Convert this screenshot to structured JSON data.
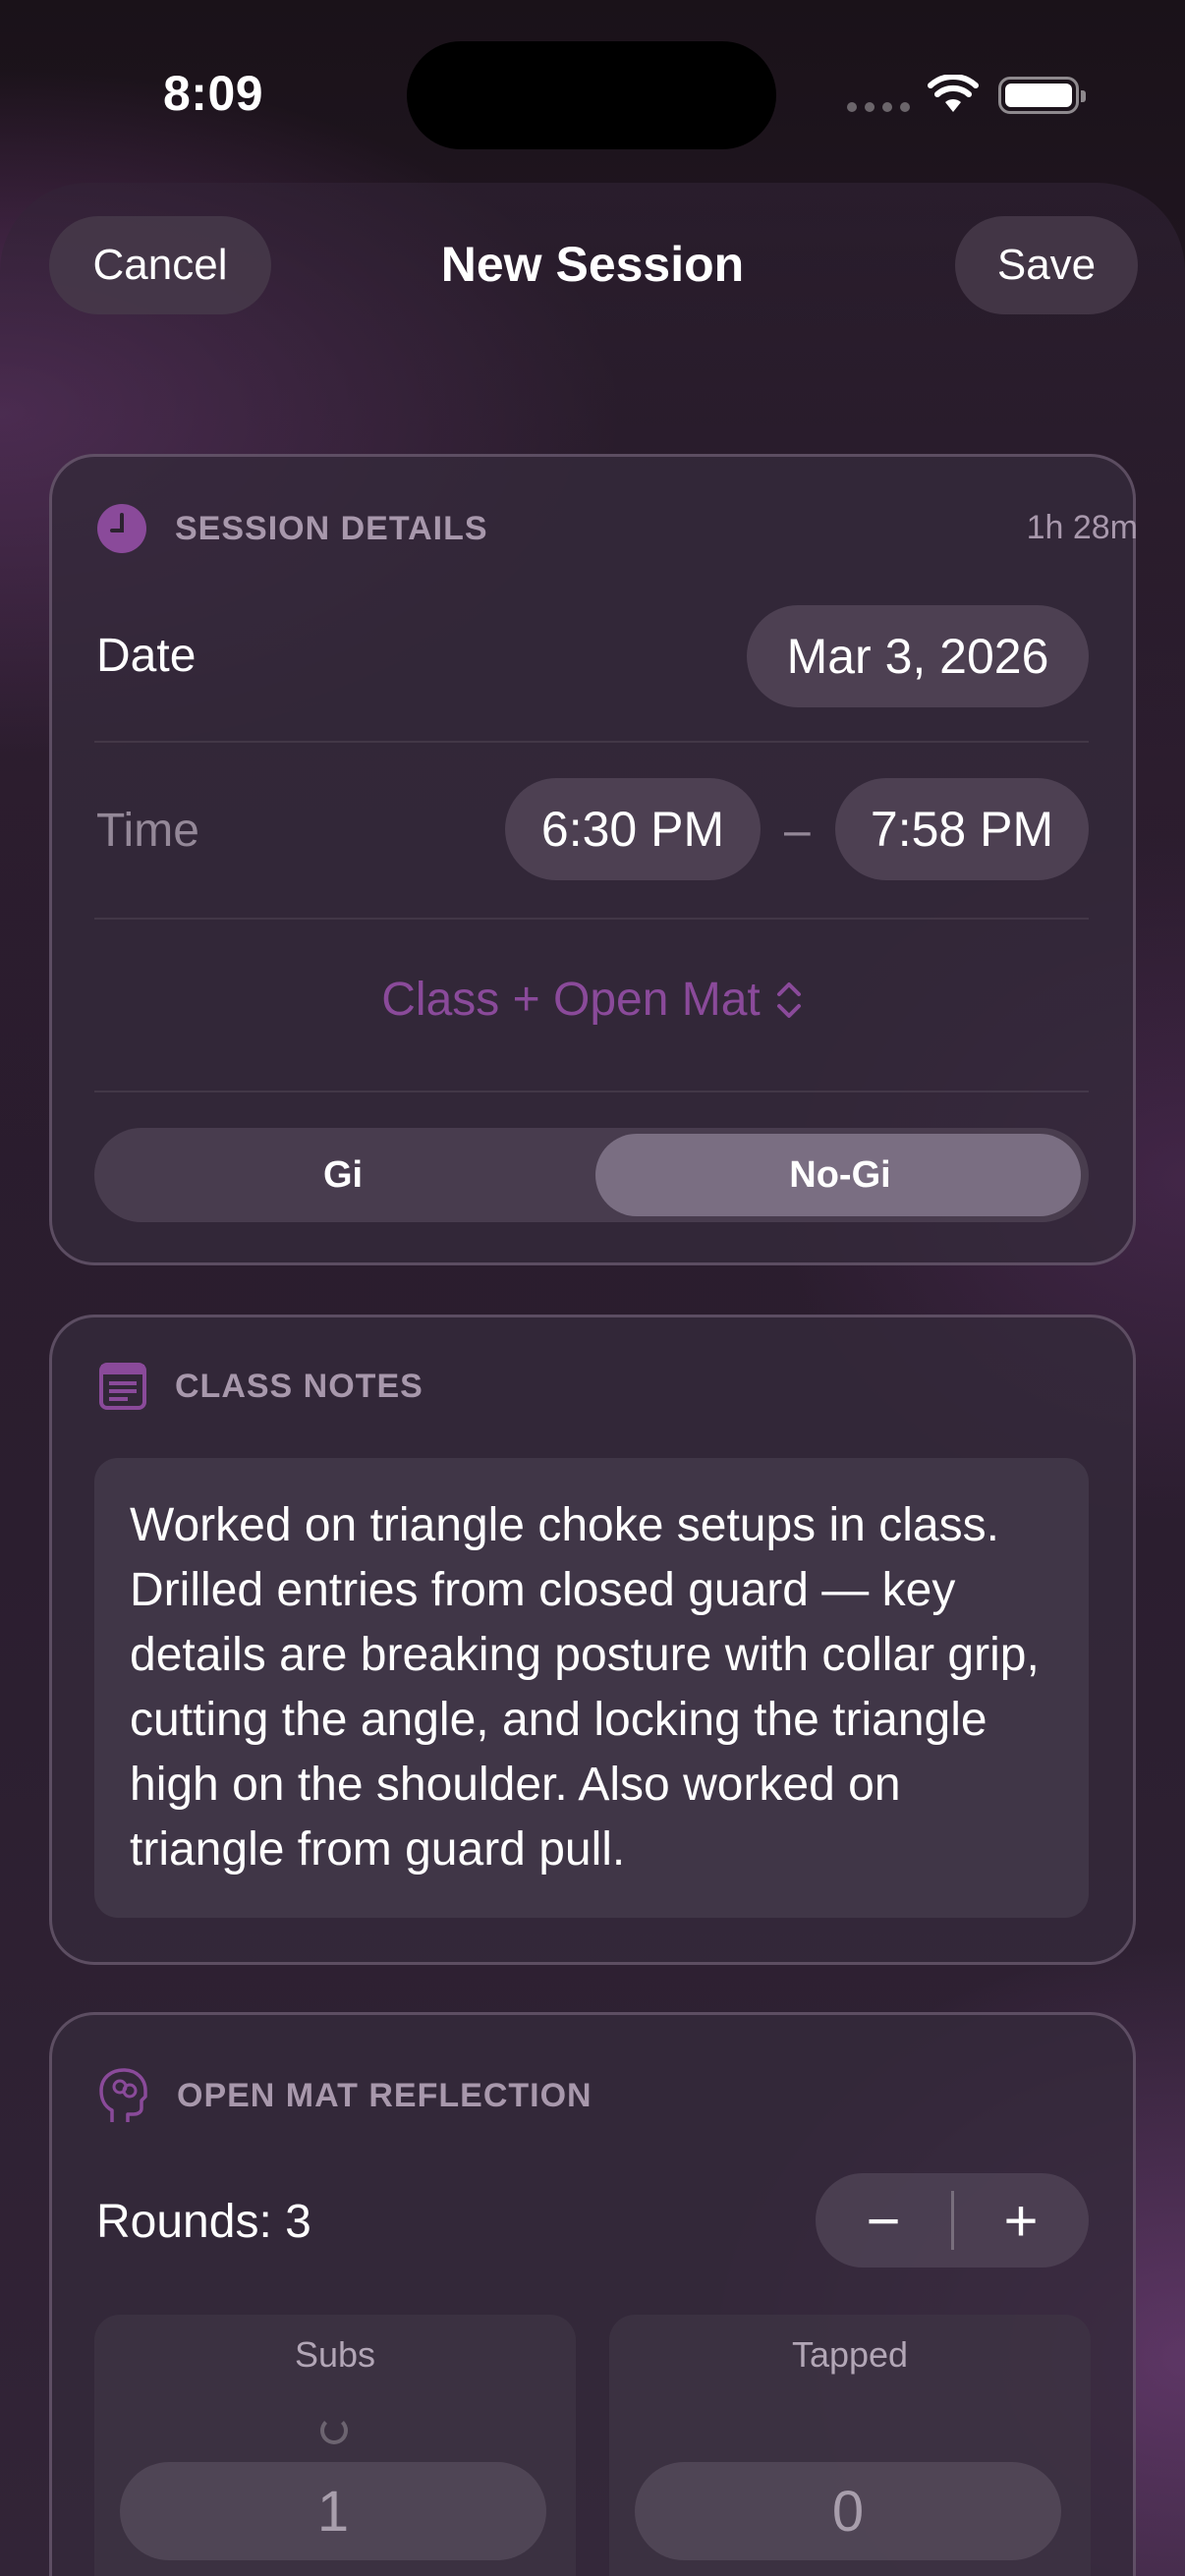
{
  "status_bar": {
    "time": "8:09"
  },
  "nav": {
    "cancel_label": "Cancel",
    "title": "New Session",
    "save_label": "Save"
  },
  "session_details": {
    "header": "SESSION DETAILS",
    "duration": "1h 28m",
    "date_label": "Date",
    "date_value": "Mar 3, 2026",
    "time_label": "Time",
    "start_time": "6:30 PM",
    "time_separator": "–",
    "end_time": "7:58 PM",
    "session_type": "Class + Open Mat",
    "segments": [
      "Gi",
      "No-Gi"
    ],
    "selected_segment": "No-Gi",
    "accent_color": "#8a4a9a"
  },
  "class_notes": {
    "header": "CLASS NOTES",
    "text": "Worked on triangle choke setups in class. Drilled entries from closed guard — key details are breaking posture with collar grip, cutting the angle, and locking the triangle high on the shoulder. Also worked on triangle from guard pull."
  },
  "open_mat": {
    "header": "OPEN MAT REFLECTION",
    "rounds_label": "Rounds: 3",
    "minus": "−",
    "plus": "+",
    "subs_label": "Subs",
    "subs_value": "1",
    "tapped_label": "Tapped",
    "tapped_value": "0"
  }
}
